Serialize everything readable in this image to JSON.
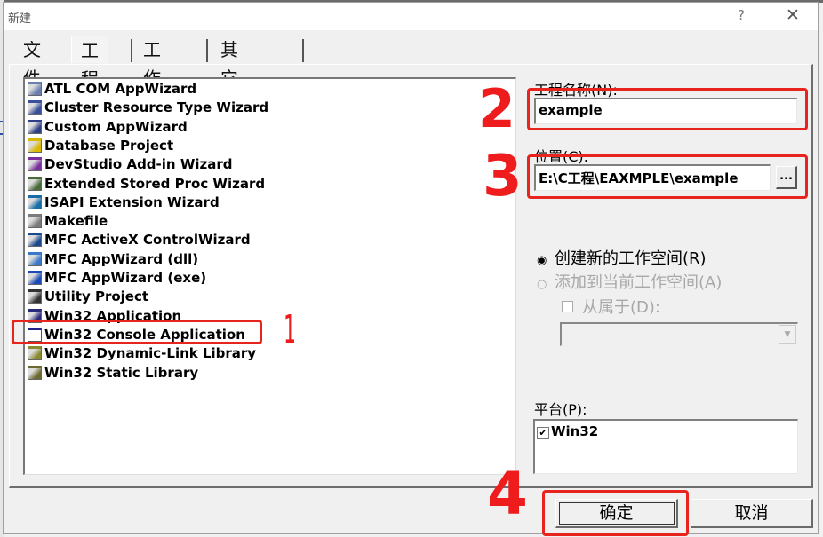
{
  "dialog": {
    "title": "新建",
    "help_label": "?",
    "close_label": "✕"
  },
  "tabs": [
    {
      "label": "文件",
      "active": false
    },
    {
      "label": "工程",
      "active": true
    },
    {
      "label": "工作区",
      "active": false
    },
    {
      "label": "其它文档",
      "active": false
    }
  ],
  "project_types": [
    {
      "label": "ATL COM AppWizard",
      "icon": "atl-wizard-icon"
    },
    {
      "label": "Cluster Resource Type Wizard",
      "icon": "cluster-wizard-icon"
    },
    {
      "label": "Custom AppWizard",
      "icon": "custom-wizard-icon"
    },
    {
      "label": "Database Project",
      "icon": "database-icon"
    },
    {
      "label": "DevStudio Add-in Wizard",
      "icon": "addin-wizard-icon"
    },
    {
      "label": "Extended Stored Proc Wizard",
      "icon": "stored-proc-icon"
    },
    {
      "label": "ISAPI Extension Wizard",
      "icon": "globe-icon"
    },
    {
      "label": "Makefile",
      "icon": "makefile-icon"
    },
    {
      "label": "MFC ActiveX ControlWizard",
      "icon": "activex-icon"
    },
    {
      "label": "MFC AppWizard (dll)",
      "icon": "mfc-dll-icon"
    },
    {
      "label": "MFC AppWizard (exe)",
      "icon": "mfc-exe-icon"
    },
    {
      "label": "Utility Project",
      "icon": "tools-icon"
    },
    {
      "label": "Win32 Application",
      "icon": "win32-app-icon"
    },
    {
      "label": "Win32 Console Application",
      "icon": "console-window-icon",
      "selected": true
    },
    {
      "label": "Win32 Dynamic-Link Library",
      "icon": "dll-library-icon"
    },
    {
      "label": "Win32 Static Library",
      "icon": "static-library-icon"
    }
  ],
  "project_name": {
    "label": "工程名称(N):",
    "value": "example"
  },
  "location": {
    "label": "位置(C):",
    "value": "E:\\C工程\\EAXMPLE\\example",
    "browse_label": "..."
  },
  "workspace": {
    "create_new_label": "创建新的工作空间(R)",
    "create_new_selected": true,
    "add_to_current_label": "添加到当前工作空间(A)",
    "add_to_current_enabled": false,
    "dependency_label": "从属于(D):",
    "dependency_checked": false,
    "dependency_value": ""
  },
  "platform": {
    "label": "平台(P):",
    "items": [
      {
        "label": "Win32",
        "checked": true
      }
    ]
  },
  "buttons": {
    "ok": "确定",
    "cancel": "取消"
  },
  "annotations": {
    "step1": "1",
    "step2": "2",
    "step3": "3",
    "step4": "4",
    "color": "#e8241e"
  }
}
